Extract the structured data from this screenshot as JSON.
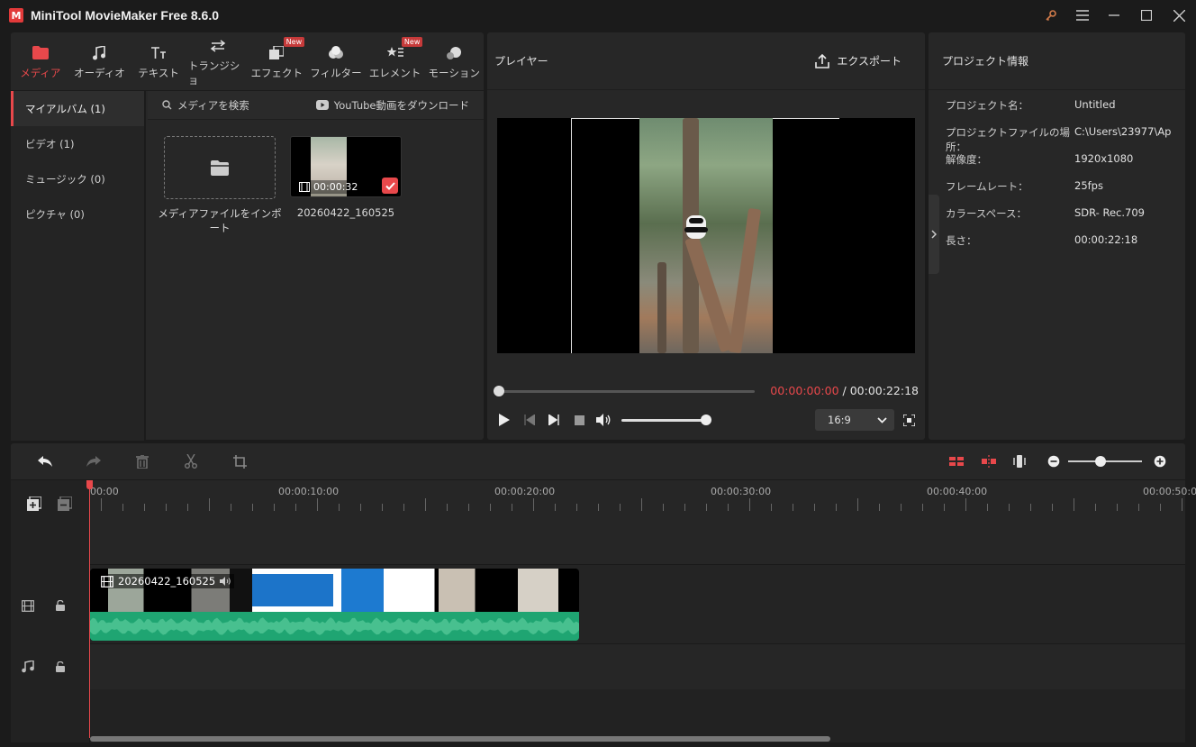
{
  "window": {
    "title": "MiniTool MovieMaker Free 8.6.0",
    "logo_letter": "M"
  },
  "media_tabs": [
    {
      "label": "メディア",
      "icon": "folder-icon",
      "active": true
    },
    {
      "label": "オーディオ",
      "icon": "music-note-icon"
    },
    {
      "label": "テキスト",
      "icon": "text-icon"
    },
    {
      "label": "トランジショ",
      "icon": "transition-arrows-icon"
    },
    {
      "label": "エフェクト",
      "icon": "effects-icon",
      "badge": "New"
    },
    {
      "label": "フィルター",
      "icon": "filter-icon"
    },
    {
      "label": "エレメント",
      "icon": "elements-icon",
      "badge": "New"
    },
    {
      "label": "モーション",
      "icon": "motion-icon"
    }
  ],
  "albums": [
    {
      "label": "マイアルバム (1)",
      "active": true
    },
    {
      "label": "ビデオ (1)"
    },
    {
      "label": "ミュージック (0)"
    },
    {
      "label": "ピクチャ (0)"
    }
  ],
  "media_toolbar": {
    "search_label": "メディアを検索",
    "youtube_label": "YouTube動画をダウンロード"
  },
  "media_items": {
    "import_label": "メディアファイルをインポート",
    "clip_duration": "00:00:32",
    "clip_name": "20260422_160525"
  },
  "player": {
    "title": "プレイヤー",
    "export_label": "エクスポート",
    "time_current": "00:00:00:00",
    "time_sep": " / ",
    "time_total": "00:00:22:18",
    "progress": 0,
    "volume": 1.0,
    "aspect_ratio": "16:9"
  },
  "project_info": {
    "title": "プロジェクト情報",
    "rows": [
      {
        "key": "プロジェクト名：",
        "value": "Untitled"
      },
      {
        "key": "プロジェクトファイルの場所：",
        "value": "C:\\Users\\23977\\Ap"
      },
      {
        "key": "解像度：",
        "value": "1920x1080"
      },
      {
        "key": "フレームレート：",
        "value": "25fps"
      },
      {
        "key": "カラースペース：",
        "value": "SDR- Rec.709"
      },
      {
        "key": "長さ：",
        "value": "00:00:22:18"
      }
    ]
  },
  "timeline": {
    "ruler_labels": [
      "00:00",
      "00:00:10:00",
      "00:00:20:00",
      "00:00:30:00",
      "00:00:40:00",
      "00:00:50:0"
    ],
    "clip_name": "20260422_160525"
  },
  "colors": {
    "accent": "#e8484b",
    "audio_wave": "#1fa572",
    "panel": "#272727",
    "background": "#1b1b1b"
  }
}
